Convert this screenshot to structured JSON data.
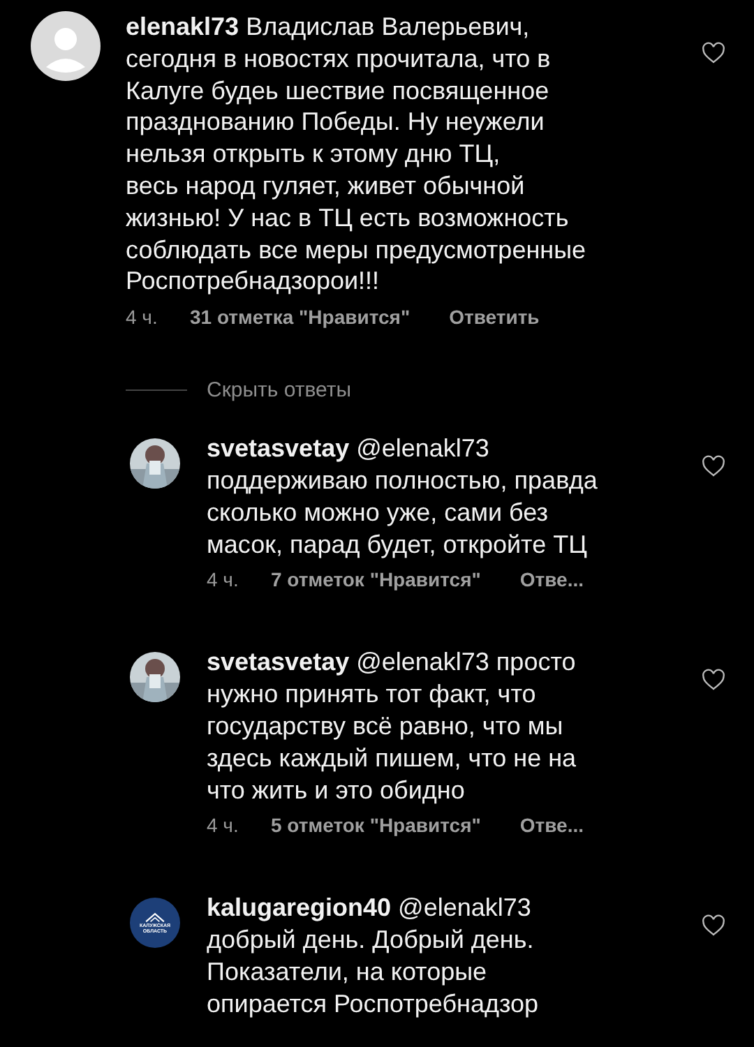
{
  "comment": {
    "avatar": {
      "kind": "default"
    },
    "text": "**elenakl73** Владислав Валерьевич,\nсегодня в новостях прочитала, что в\nКалуге будеь шествие посвященное\nпразднованию Победы. Ну неужели\nнельзя открыть к этому дню ТЦ,\nвесь народ гуляет, живет обычной\nжизнью! У нас в ТЦ есть возможность\nсоблюдать все меры предусмотренные\nРоспотребнадзорои!!!",
    "time": "4 ч.",
    "likes": "31 отметка \"Нравится\"",
    "reply": "Ответить"
  },
  "hide_replies": "Скрыть ответы",
  "replies": [
    {
      "text": "**svetasvetay** @elenakl73\nподдерживаю полностью, правда\nсколько можно уже, сами без\nмасок, парад будет, откройте ТЦ",
      "time": "4 ч.",
      "likes": "7 отметок \"Нравится\"",
      "reply": "Отве..."
    },
    {
      "text": "**svetasvetay** @elenakl73 просто\nнужно принять тот факт, что\nгосударству всё равно, что мы\nздесь каждый пишем, что не на\nчто жить и это обидно",
      "time": "4 ч.",
      "likes": "5 отметок \"Нравится\"",
      "reply": "Отве..."
    },
    {
      "avatar": {
        "kind": "logo",
        "lines": [
          "КАЛУЖСКАЯ",
          "ОБЛАСТЬ"
        ]
      },
      "text": "**kalugaregion40** @elenakl73\nдобрый день. Добрый день.\nПоказатели, на которые\nопирается Роспотребнадзор"
    }
  ]
}
